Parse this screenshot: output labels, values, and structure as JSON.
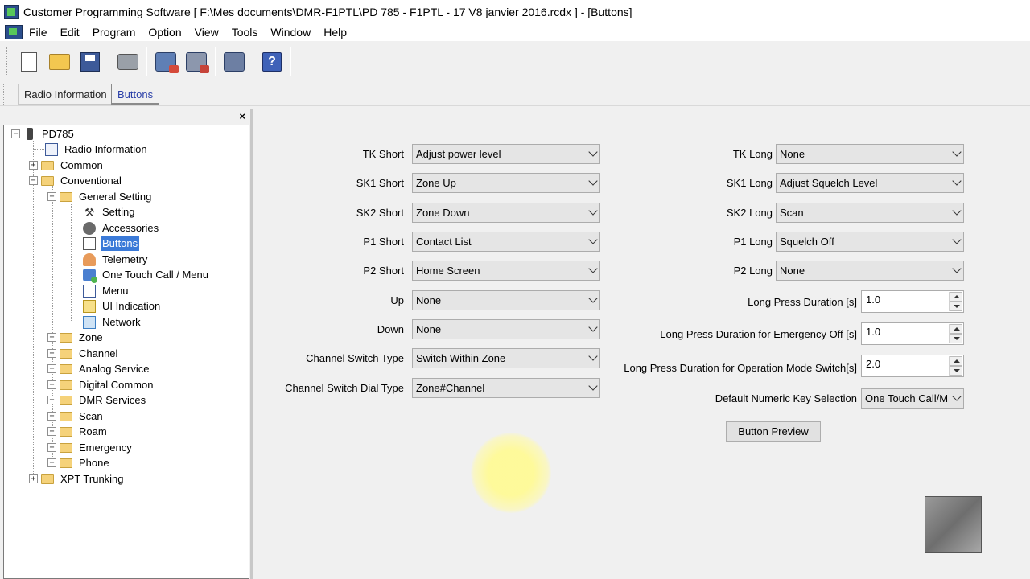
{
  "window": {
    "title": "Customer Programming Software [ F:\\Mes documents\\DMR-F1PTL\\PD 785 - F1PTL - 17 V8 janvier 2016.rcdx ] - [Buttons]"
  },
  "menubar": {
    "items": [
      "File",
      "Edit",
      "Program",
      "Option",
      "View",
      "Tools",
      "Window",
      "Help"
    ]
  },
  "toolbar": {
    "icons": [
      "new-file-icon",
      "open-folder-icon",
      "save-icon",
      "print-icon",
      "read-radio-icon",
      "write-radio-icon",
      "clone-icon",
      "help-icon"
    ],
    "help_glyph": "?"
  },
  "tabs": [
    {
      "label": "Radio Information",
      "active": false
    },
    {
      "label": "Buttons",
      "active": true
    }
  ],
  "panel": {
    "close_glyph": "×"
  },
  "tree": {
    "nodes": [
      {
        "label": "PD785",
        "expander": "−"
      },
      {
        "label": "Radio Information"
      },
      {
        "label": "Common",
        "expander": "+"
      },
      {
        "label": "Conventional",
        "expander": "−"
      },
      {
        "label": "General Setting",
        "expander": "−"
      },
      {
        "label": "Setting"
      },
      {
        "label": "Accessories"
      },
      {
        "label": "Buttons",
        "selected": true
      },
      {
        "label": "Telemetry"
      },
      {
        "label": "One Touch Call / Menu"
      },
      {
        "label": "Menu"
      },
      {
        "label": "UI Indication"
      },
      {
        "label": "Network"
      },
      {
        "label": "Zone",
        "expander": "+"
      },
      {
        "label": "Channel",
        "expander": "+"
      },
      {
        "label": "Analog Service",
        "expander": "+"
      },
      {
        "label": "Digital Common",
        "expander": "+"
      },
      {
        "label": "DMR Services",
        "expander": "+"
      },
      {
        "label": "Scan",
        "expander": "+"
      },
      {
        "label": "Roam",
        "expander": "+"
      },
      {
        "label": "Emergency",
        "expander": "+"
      },
      {
        "label": "Phone",
        "expander": "+"
      },
      {
        "label": "XPT Trunking",
        "expander": "+"
      }
    ]
  },
  "form": {
    "left": [
      {
        "label": "TK Short",
        "value": "Adjust power level"
      },
      {
        "label": "SK1 Short",
        "value": "Zone Up"
      },
      {
        "label": "SK2 Short",
        "value": "Zone Down"
      },
      {
        "label": "P1 Short",
        "value": "Contact List"
      },
      {
        "label": "P2 Short",
        "value": "Home Screen"
      },
      {
        "label": "Up",
        "value": "None"
      },
      {
        "label": "Down",
        "value": "None"
      },
      {
        "label": "Channel Switch Type",
        "value": "Switch Within Zone"
      },
      {
        "label": "Channel Switch Dial Type",
        "value": "Zone#Channel"
      }
    ],
    "right": [
      {
        "label": "TK Long",
        "value": "None"
      },
      {
        "label": "SK1 Long",
        "value": "Adjust Squelch Level"
      },
      {
        "label": "SK2 Long",
        "value": "Scan"
      },
      {
        "label": "P1 Long",
        "value": "Squelch Off"
      },
      {
        "label": "P2 Long",
        "value": "None"
      }
    ],
    "spinners": [
      {
        "label": "Long Press Duration [s]",
        "value": "1.0"
      },
      {
        "label": "Long Press Duration for Emergency Off [s]",
        "value": "1.0"
      },
      {
        "label": "Long Press Duration for Operation Mode Switch[s]",
        "value": "2.0"
      }
    ],
    "default_key": {
      "label": "Default Numeric Key Selection",
      "value": "One Touch Call/M"
    },
    "preview_button": "Button Preview"
  }
}
